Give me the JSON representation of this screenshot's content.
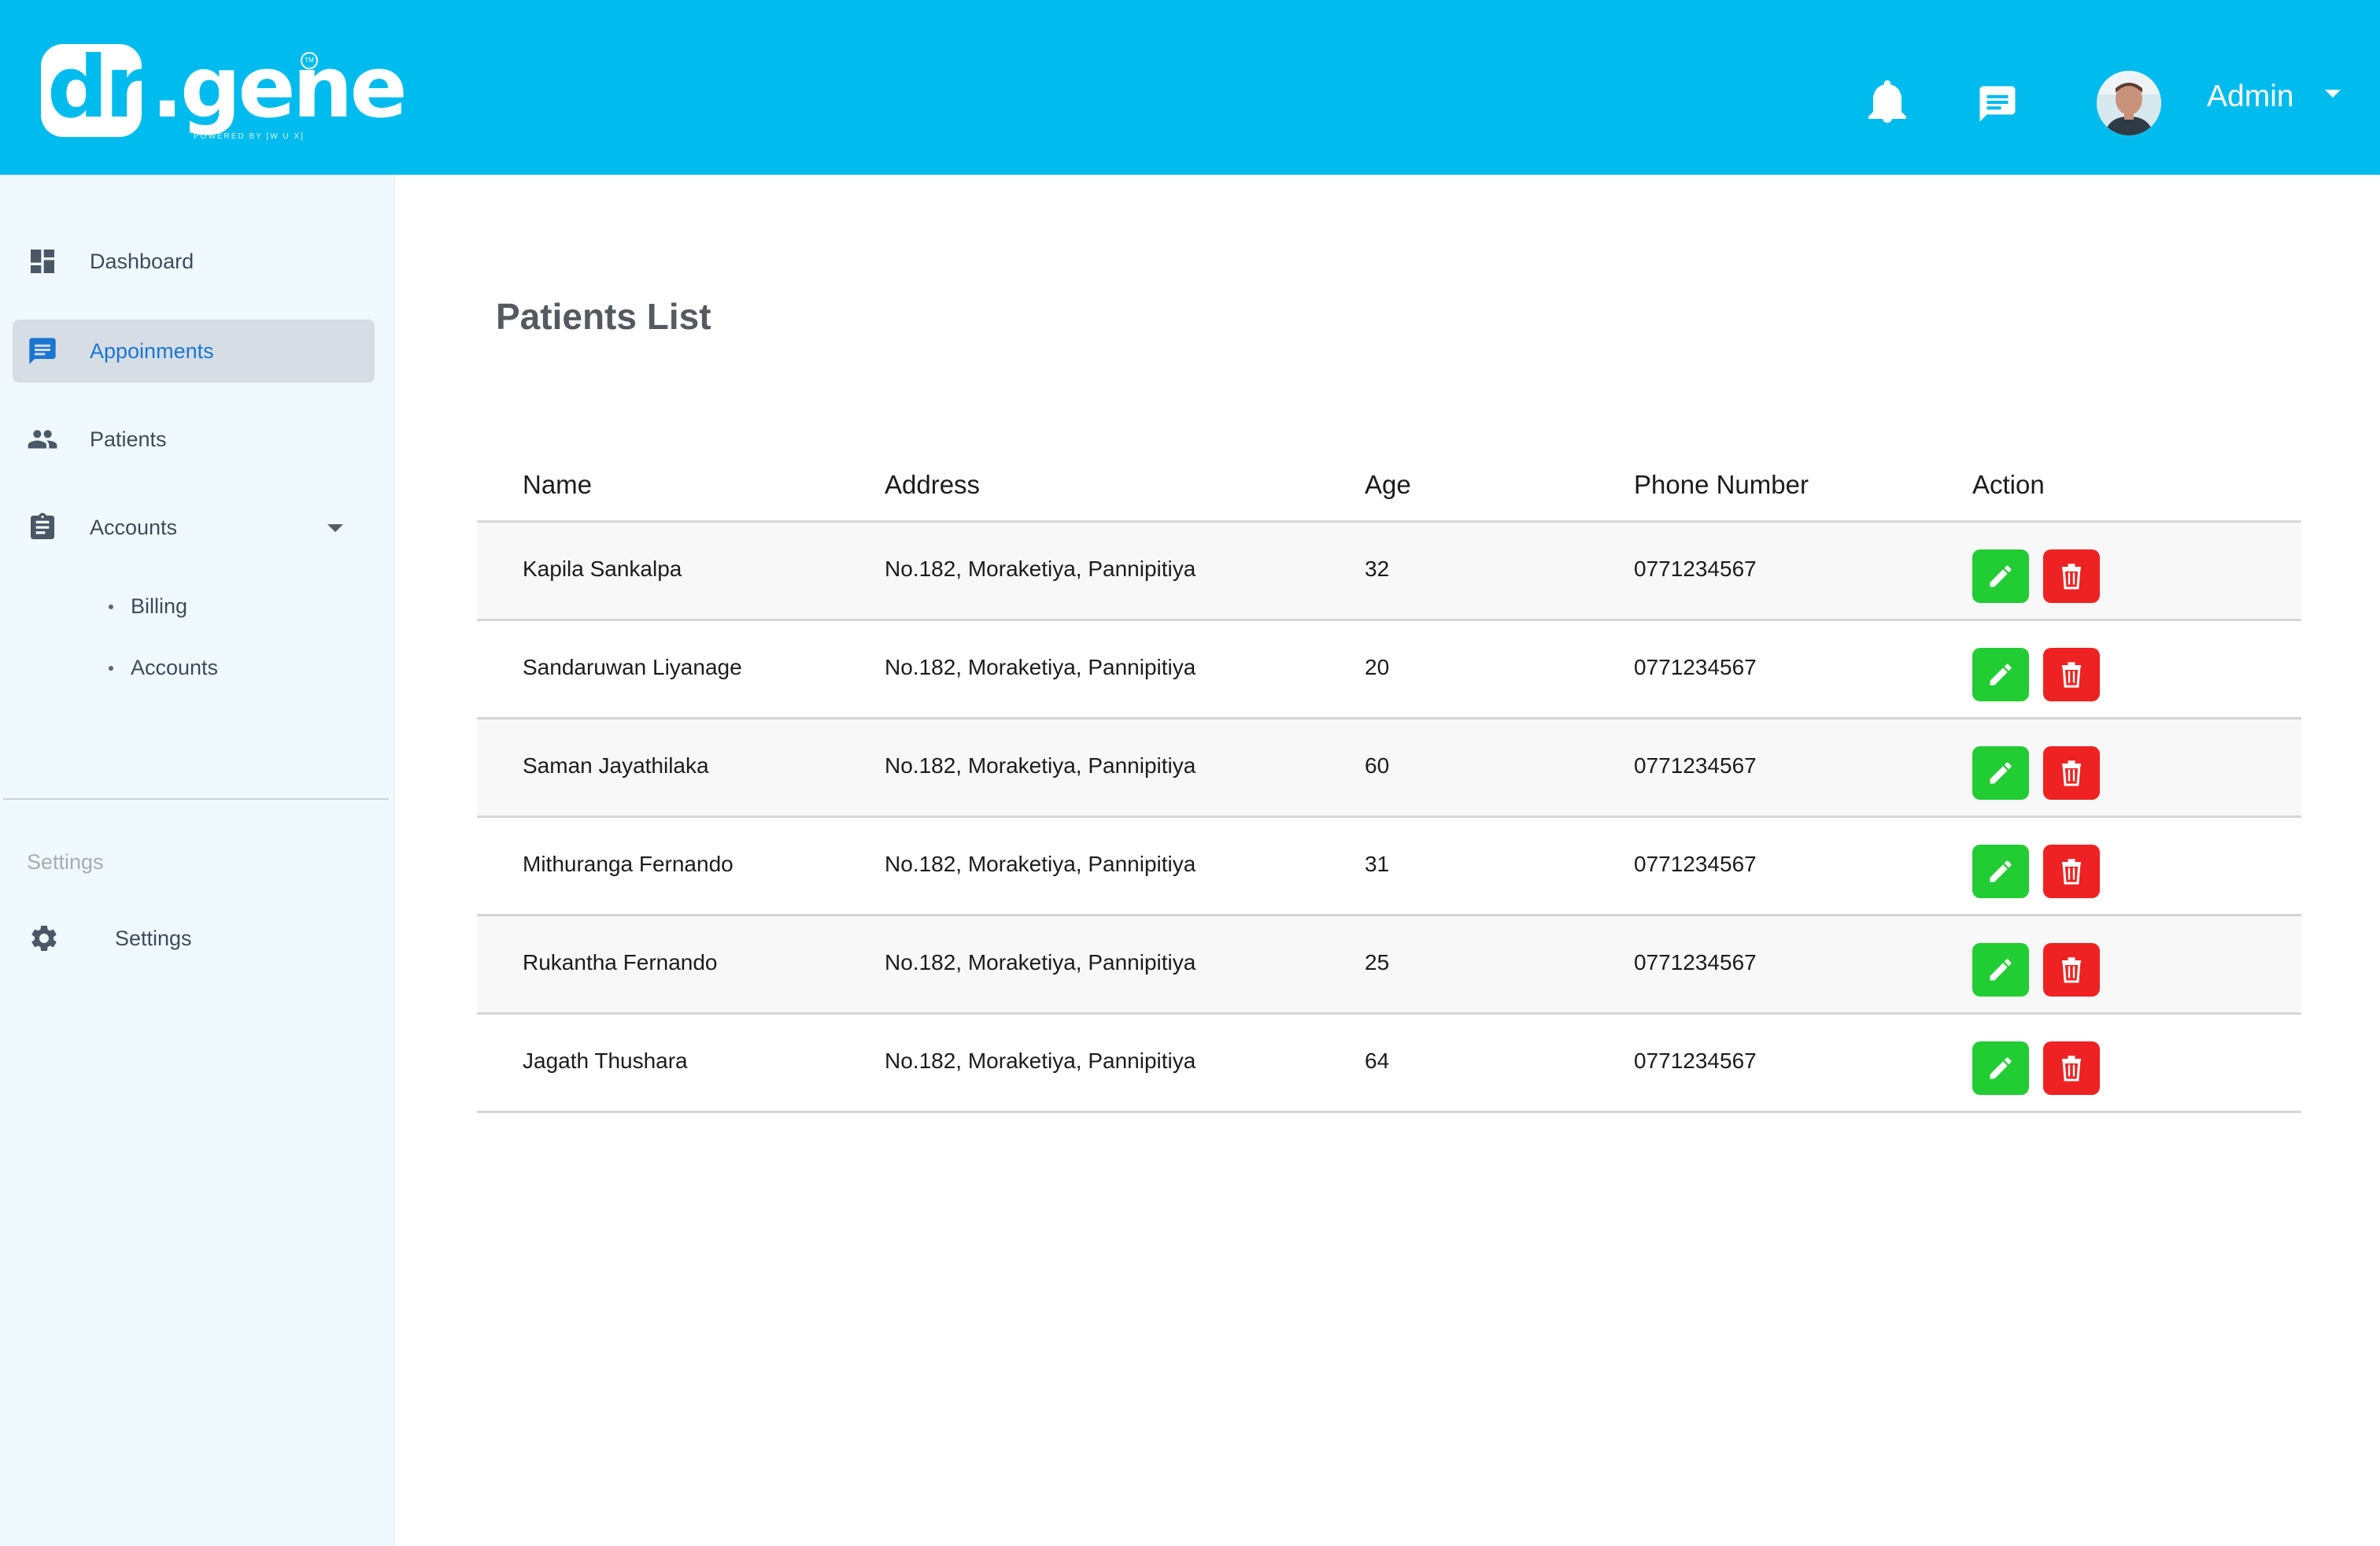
{
  "brand": {
    "logo_box_text": "dr",
    "logo_rest_text": ".gene",
    "tm": "TM",
    "tagline": "POWERED BY [W U X]",
    "primary_color": "#00bbee"
  },
  "header": {
    "notification_icon": "bell-icon",
    "message_icon": "chat-icon",
    "user_name": "Admin"
  },
  "sidebar": {
    "items": [
      {
        "label": "Dashboard",
        "icon": "dashboard-icon"
      },
      {
        "label": "Appoinments",
        "icon": "chat-icon"
      },
      {
        "label": "Patients",
        "icon": "people-icon"
      },
      {
        "label": "Accounts",
        "icon": "clipboard-icon"
      }
    ],
    "sub_items": [
      {
        "label": "Billing"
      },
      {
        "label": "Accounts"
      }
    ],
    "section_label": "Settings",
    "settings_item": {
      "label": "Settings",
      "icon": "gear-icon"
    }
  },
  "main": {
    "title": "Patients List",
    "columns": [
      "Name",
      "Address",
      "Age",
      "Phone Number",
      "Action"
    ],
    "rows": [
      {
        "name": "Kapila Sankalpa",
        "address": "No.182, Moraketiya, Pannipitiya",
        "age": "32",
        "phone": "0771234567"
      },
      {
        "name": "Sandaruwan Liyanage",
        "address": "No.182, Moraketiya, Pannipitiya",
        "age": "20",
        "phone": "0771234567"
      },
      {
        "name": "Saman Jayathilaka",
        "address": "No.182, Moraketiya, Pannipitiya",
        "age": "60",
        "phone": "0771234567"
      },
      {
        "name": "Mithuranga Fernando",
        "address": "No.182, Moraketiya, Pannipitiya",
        "age": "31",
        "phone": "0771234567"
      },
      {
        "name": "Rukantha Fernando",
        "address": "No.182, Moraketiya, Pannipitiya",
        "age": "25",
        "phone": "0771234567"
      },
      {
        "name": "Jagath Thushara",
        "address": "No.182, Moraketiya, Pannipitiya",
        "age": "64",
        "phone": "0771234567"
      }
    ],
    "edit_color": "#22cc33",
    "delete_color": "#ee2222"
  }
}
